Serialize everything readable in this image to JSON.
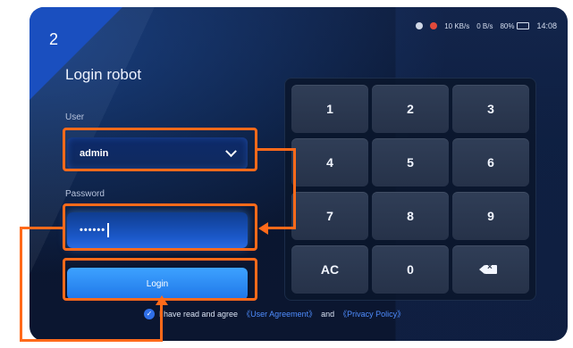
{
  "step_number": "2",
  "status_bar": {
    "net_speed_1": "10 KB/s",
    "net_speed_2": "0 B/s",
    "battery": "80%",
    "time": "14:08"
  },
  "login": {
    "title": "Login robot",
    "user_label": "User",
    "user_value": "admin",
    "password_label": "Password",
    "password_value": "••••••",
    "login_button": "Login",
    "agree_text": "I have read and agree",
    "user_agreement": "《User Agreement》",
    "and_text": "and",
    "privacy_policy": "《Privacy Policy》"
  },
  "keypad": {
    "keys": [
      "1",
      "2",
      "3",
      "4",
      "5",
      "6",
      "7",
      "8",
      "9",
      "AC",
      "0"
    ]
  },
  "colors": {
    "annotation": "#ff6a1a",
    "accent": "#2f6fe8",
    "background": "#0b1630"
  }
}
